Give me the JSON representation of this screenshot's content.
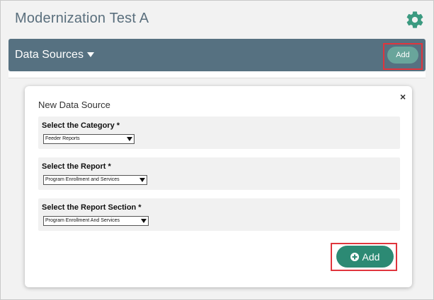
{
  "app": {
    "title": "Modernization Test A"
  },
  "icons": {
    "settings": "gear-icon",
    "close": "close-icon",
    "add": "plus-circle-icon",
    "dropdown": "caret-down-icon"
  },
  "colors": {
    "header_bar": "#567181",
    "add_small": "#69a59b",
    "add_primary": "#2c8a74",
    "highlight": "#e0353d"
  },
  "section": {
    "title": "Data Sources",
    "add_label": "Add"
  },
  "modal": {
    "title": "New Data Source",
    "close_symbol": "×",
    "fields": [
      {
        "label": "Select the Category *",
        "value": "Feeder Reports"
      },
      {
        "label": "Select the Report *",
        "value": "Program Enrollment and Services"
      },
      {
        "label": "Select the Report Section *",
        "value": "Program Enrollment And Services"
      }
    ],
    "add_label": "Add"
  }
}
